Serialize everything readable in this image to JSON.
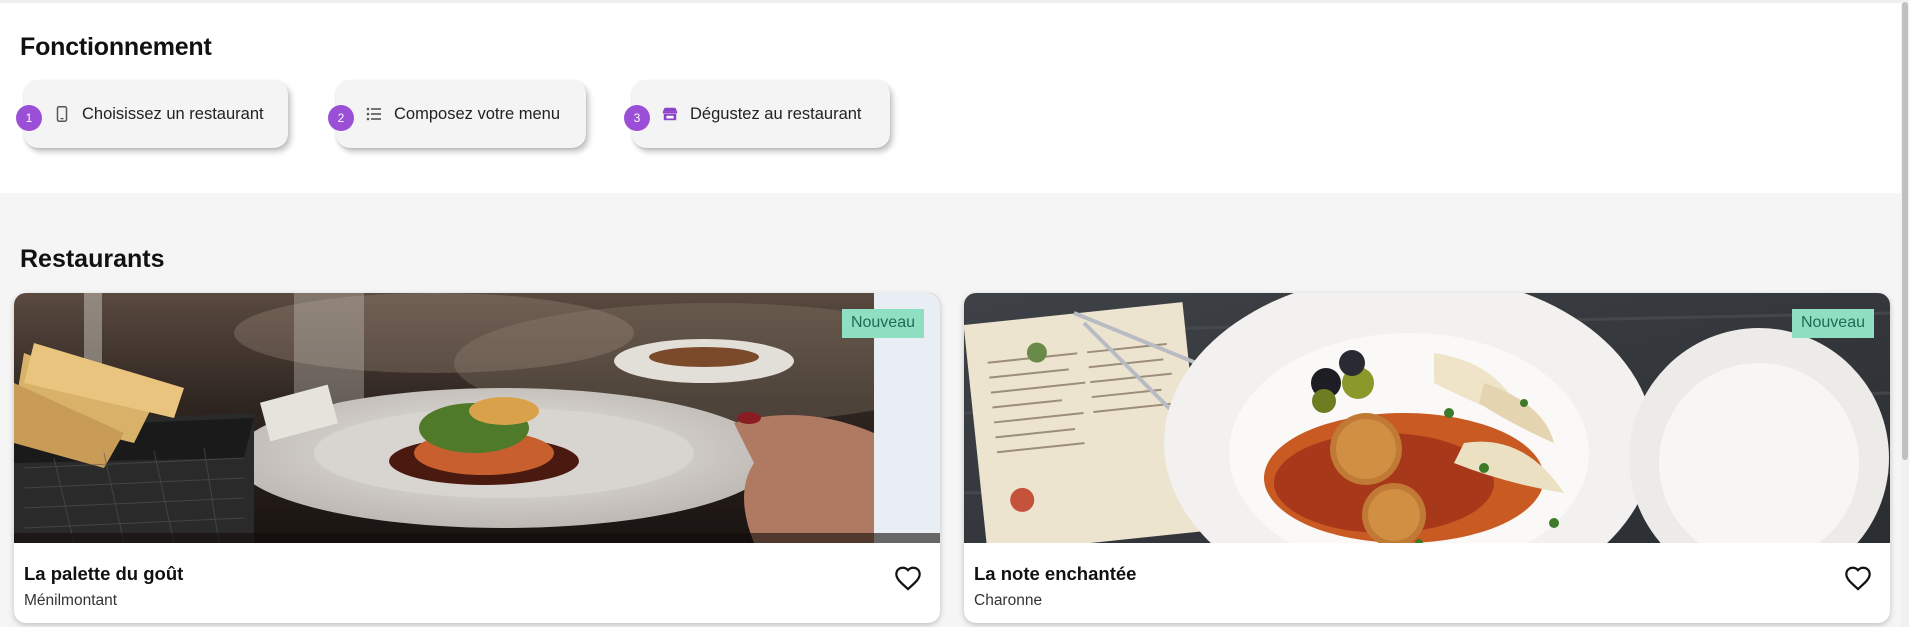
{
  "how_it_works": {
    "title": "Fonctionnement",
    "steps": [
      {
        "number": "1",
        "icon": "smartphone-icon",
        "label": "Choisissez un restaurant"
      },
      {
        "number": "2",
        "icon": "list-icon",
        "label": "Composez votre menu"
      },
      {
        "number": "3",
        "icon": "store-icon",
        "label": "Dégustez au restaurant"
      }
    ]
  },
  "restaurants": {
    "title": "Restaurants",
    "cards": [
      {
        "name": "La palette du goût",
        "area": "Ménilmontant",
        "tag": "Nouveau",
        "favorite_icon": "heart-outline-icon"
      },
      {
        "name": "La note enchantée",
        "area": "Charonne",
        "tag": "Nouveau",
        "favorite_icon": "heart-outline-icon"
      }
    ]
  },
  "colors": {
    "accent": "#9b4fd6",
    "tag_background": "#8fe0c2",
    "tag_text": "#1f6b53",
    "section_background": "#f5f5f5"
  }
}
